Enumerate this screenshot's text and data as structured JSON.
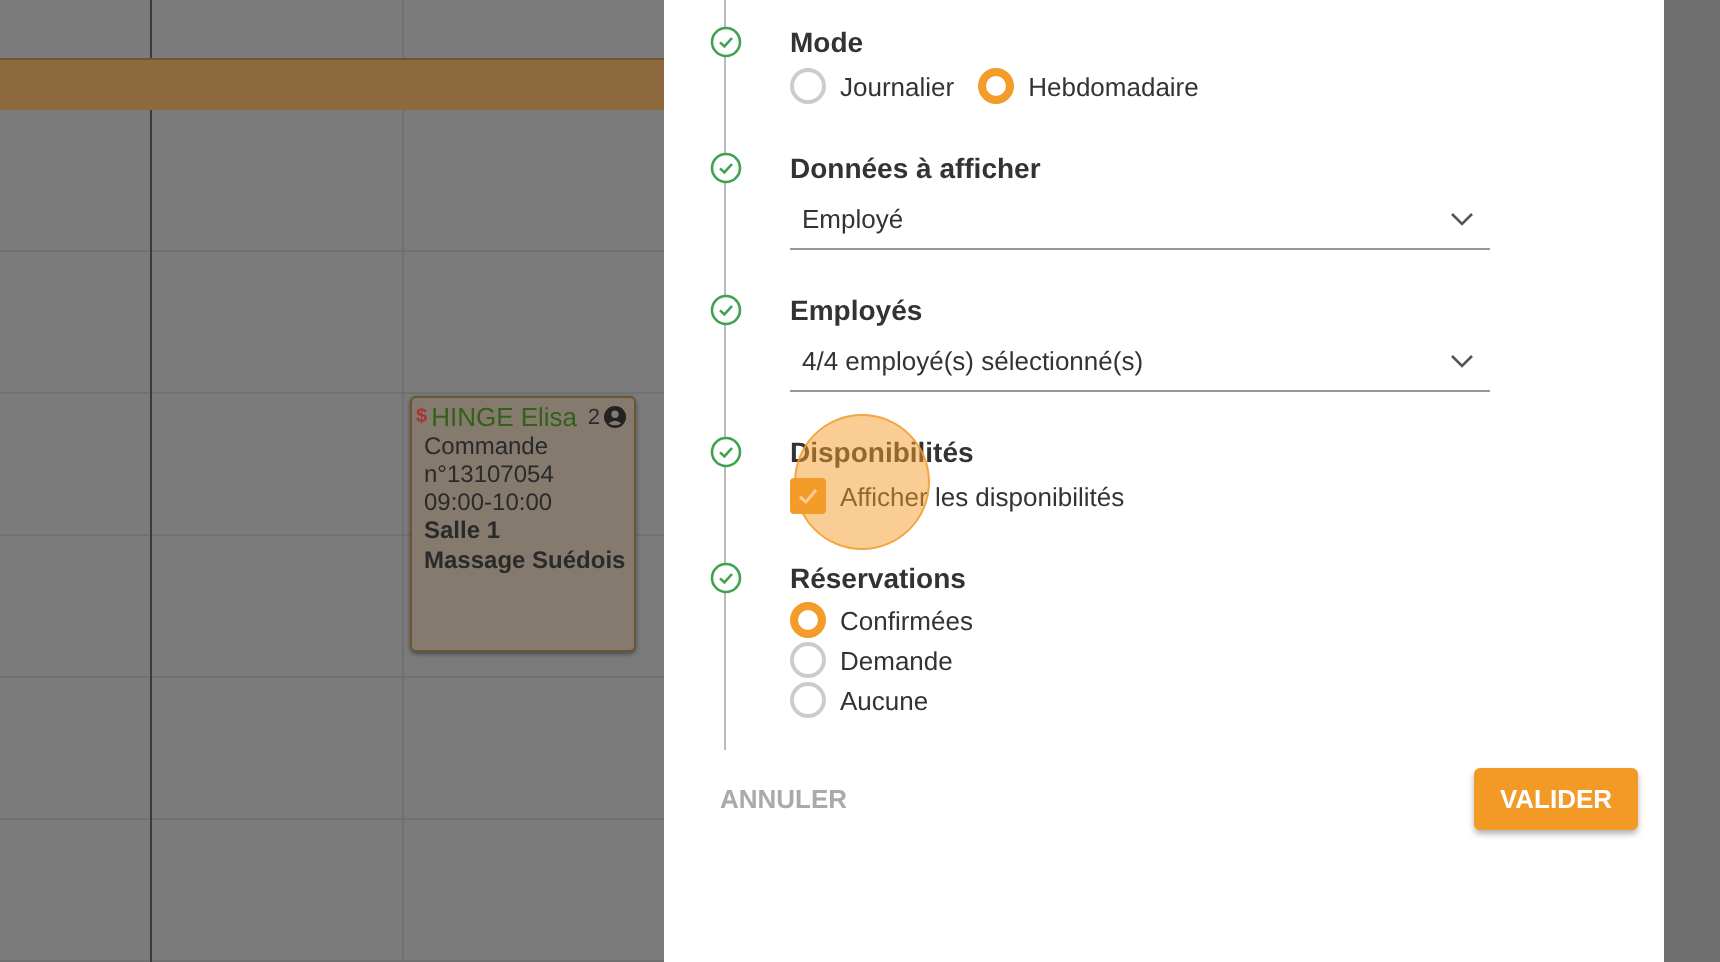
{
  "calendar": {
    "event": {
      "currency": "$",
      "title": "HINGE Elisa",
      "count": "2",
      "lines": [
        {
          "text": "Commande",
          "bold": false
        },
        {
          "text": "n°13107054",
          "bold": false
        },
        {
          "text": "09:00-10:00",
          "bold": false
        },
        {
          "text": "Salle 1",
          "bold": true
        },
        {
          "text": "Massage Suédois",
          "bold": true
        }
      ]
    }
  },
  "dialog": {
    "steps": [
      {
        "kind": "radio-inline",
        "done": true,
        "title": "Mode",
        "options": [
          {
            "label": "Journalier",
            "selected": false
          },
          {
            "label": "Hebdomadaire",
            "selected": true
          }
        ]
      },
      {
        "kind": "select",
        "done": true,
        "title": "Données à afficher",
        "value": "Employé"
      },
      {
        "kind": "select",
        "done": true,
        "title": "Employés",
        "value": "4/4 employé(s) sélectionné(s)"
      },
      {
        "kind": "checkbox",
        "done": true,
        "title": "Disponibilités",
        "label": "Afficher les disponibilités",
        "checked": true
      },
      {
        "kind": "radio",
        "done": true,
        "title": "Réservations",
        "options": [
          {
            "label": "Confirmées",
            "selected": true
          },
          {
            "label": "Demande",
            "selected": false
          },
          {
            "label": "Aucune",
            "selected": false
          }
        ]
      }
    ],
    "buttons": [
      {
        "kind": "text",
        "label": "ANNULER"
      },
      {
        "kind": "raised",
        "label": "VALIDER"
      }
    ]
  }
}
